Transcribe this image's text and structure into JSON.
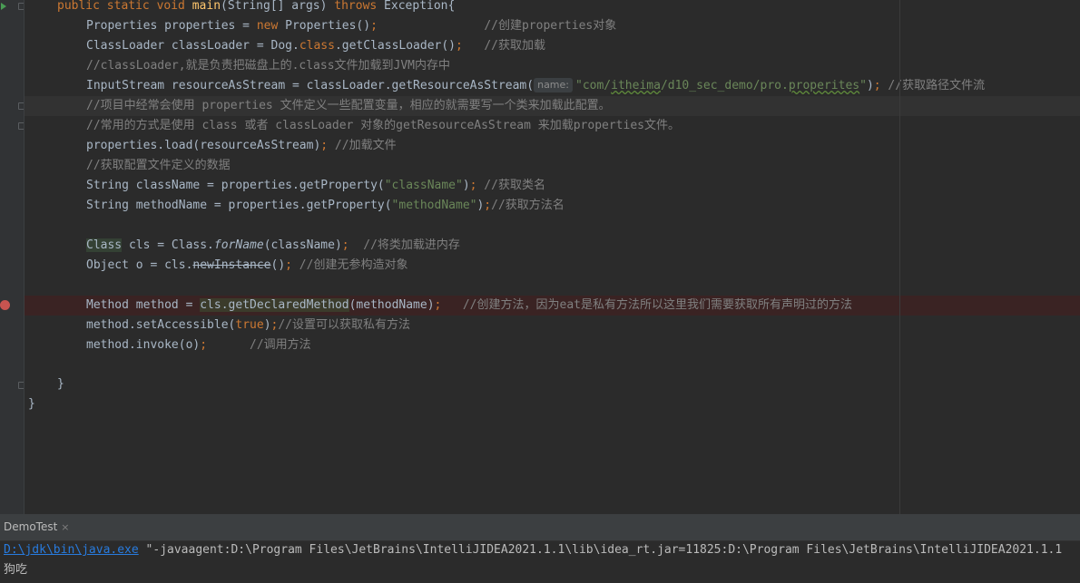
{
  "code": {
    "l0": {
      "kw1": "public static void ",
      "fn": "main",
      "p1": "(String[] args) ",
      "kw2": "throws",
      "p2": " Exception{"
    },
    "l1": {
      "t1": "Properties properties = ",
      "kw": "new",
      "t2": " Properties()",
      "semi": ";",
      "pad": "               ",
      "cm": "//创建properties对象"
    },
    "l2": {
      "t1": "ClassLoader classLoader = Dog.",
      "kw": "class",
      "t2": ".getClassLoader()",
      "semi": ";",
      "pad": "   ",
      "cm": "//获取加载"
    },
    "l3": {
      "cm": "//classLoader,就是负责把磁盘上的.class文件加载到JVM内存中"
    },
    "l4": {
      "t1": "InputStream resourceAsStream = classLoader.getResourceAsStream(",
      "hint": "name:",
      "q1": "\"com/",
      "s1": "itheima",
      "s2": "/d10_sec_demo/pro.",
      "s3": "properites",
      "q2": "\"",
      "t2": ")",
      "semi": ";",
      "cm": " //获取路径文件流"
    },
    "l5": {
      "cm": "//项目中经常会使用 properties 文件定义一些配置变量，相应的就需要写一个类来加载此配置。"
    },
    "l6": {
      "cm": "//常用的方式是使用 class 或者 classLoader 对象的getResourceAsStream 来加载properties文件。"
    },
    "l7": {
      "t1": "properties.load(resourceAsStream)",
      "semi": ";",
      "cm": " //加载文件"
    },
    "l8": {
      "cm": "//获取配置文件定义的数据"
    },
    "l9": {
      "t1": "String className = properties.getProperty(",
      "str": "\"className\"",
      "t2": ")",
      "semi": ";",
      "cm": " //获取类名"
    },
    "l10": {
      "t1": "String methodName = properties.getProperty(",
      "str": "\"methodName\"",
      "t2": ")",
      "semi": ";",
      "cm": "//获取方法名"
    },
    "l11": {
      "cls": "Class",
      "t1": " cls = Class.",
      "it": "forName",
      "t2": "(className)",
      "semi": ";",
      "cm": "  //将类加载进内存"
    },
    "l12": {
      "t1": "Object o = cls.",
      "strike": "newInstance",
      "t2": "()",
      "semi": ";",
      "cm": " //创建无参构造对象"
    },
    "l13": {
      "t1": "Method method = ",
      "call": "cls.getDeclaredMethod",
      "t2": "(methodName)",
      "semi": ";",
      "cm": "   //创建方法，因为eat是私有方法所以这里我们需要获取所有声明过的方法"
    },
    "l14": {
      "t1": "method.setAccessible(",
      "kw": "true",
      "t2": ")",
      "semi": ";",
      "cm": "//设置可以获取私有方法"
    },
    "l15": {
      "t1": "method.invoke(o)",
      "semi": ";",
      "cm": "      //调用方法"
    },
    "l16": {
      "t": "}"
    },
    "l17": {
      "t": "}"
    }
  },
  "run": {
    "tab_label": "DemoTest",
    "tab_close": "×",
    "console_link": "D:\\jdk\\bin\\java.exe",
    "console_cmd": " \"-javaagent:D:\\Program Files\\JetBrains\\IntelliJIDEA2021.1.1\\lib\\idea_rt.jar=11825:D:\\Program Files\\JetBrains\\IntelliJIDEA2021.1.1",
    "console_output": "狗吃"
  },
  "colors": {
    "keyword": "#cc7832",
    "function": "#ffc66d",
    "string": "#6a8759",
    "comment": "#808080",
    "breakpoint": "#c75450",
    "link": "#287bde"
  }
}
